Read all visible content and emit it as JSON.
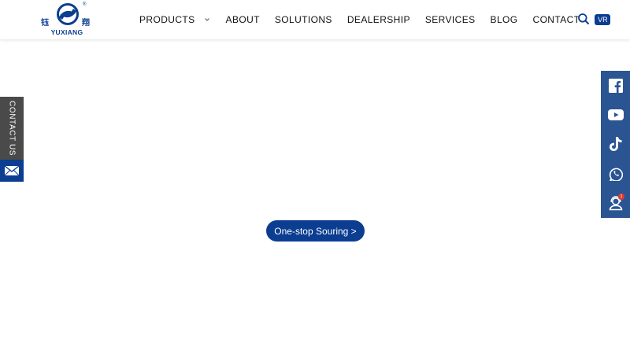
{
  "header": {
    "logo": {
      "brand_name": "YUXIANG",
      "chinese_left": "钰",
      "chinese_right": "翔",
      "mark": "®"
    },
    "nav": [
      {
        "label": "PRODUCTS",
        "has_dropdown": true
      },
      {
        "label": "ABOUT"
      },
      {
        "label": "SOLUTIONS"
      },
      {
        "label": "DEALERSHIP"
      },
      {
        "label": "SERVICES"
      },
      {
        "label": "BLOG"
      },
      {
        "label": "CONTACT"
      }
    ],
    "vr_badge": "VR",
    "search_icon": "search-icon"
  },
  "left_float": {
    "contact_label": "CONTACT US",
    "mail_icon": "mail-icon"
  },
  "social_bar": {
    "icons": [
      "facebook-icon",
      "youtube-icon",
      "tiktok-icon",
      "whatsapp-icon",
      "support-agent-icon"
    ],
    "notification_count": "1"
  },
  "hero": {
    "cta_label": "One-stop Souring >"
  },
  "colors": {
    "brand_blue": "#0b3d91",
    "social_bar_blue": "#2b5592",
    "contact_tab_gray": "#4a4a4a",
    "notification_red": "#e03a2f"
  }
}
